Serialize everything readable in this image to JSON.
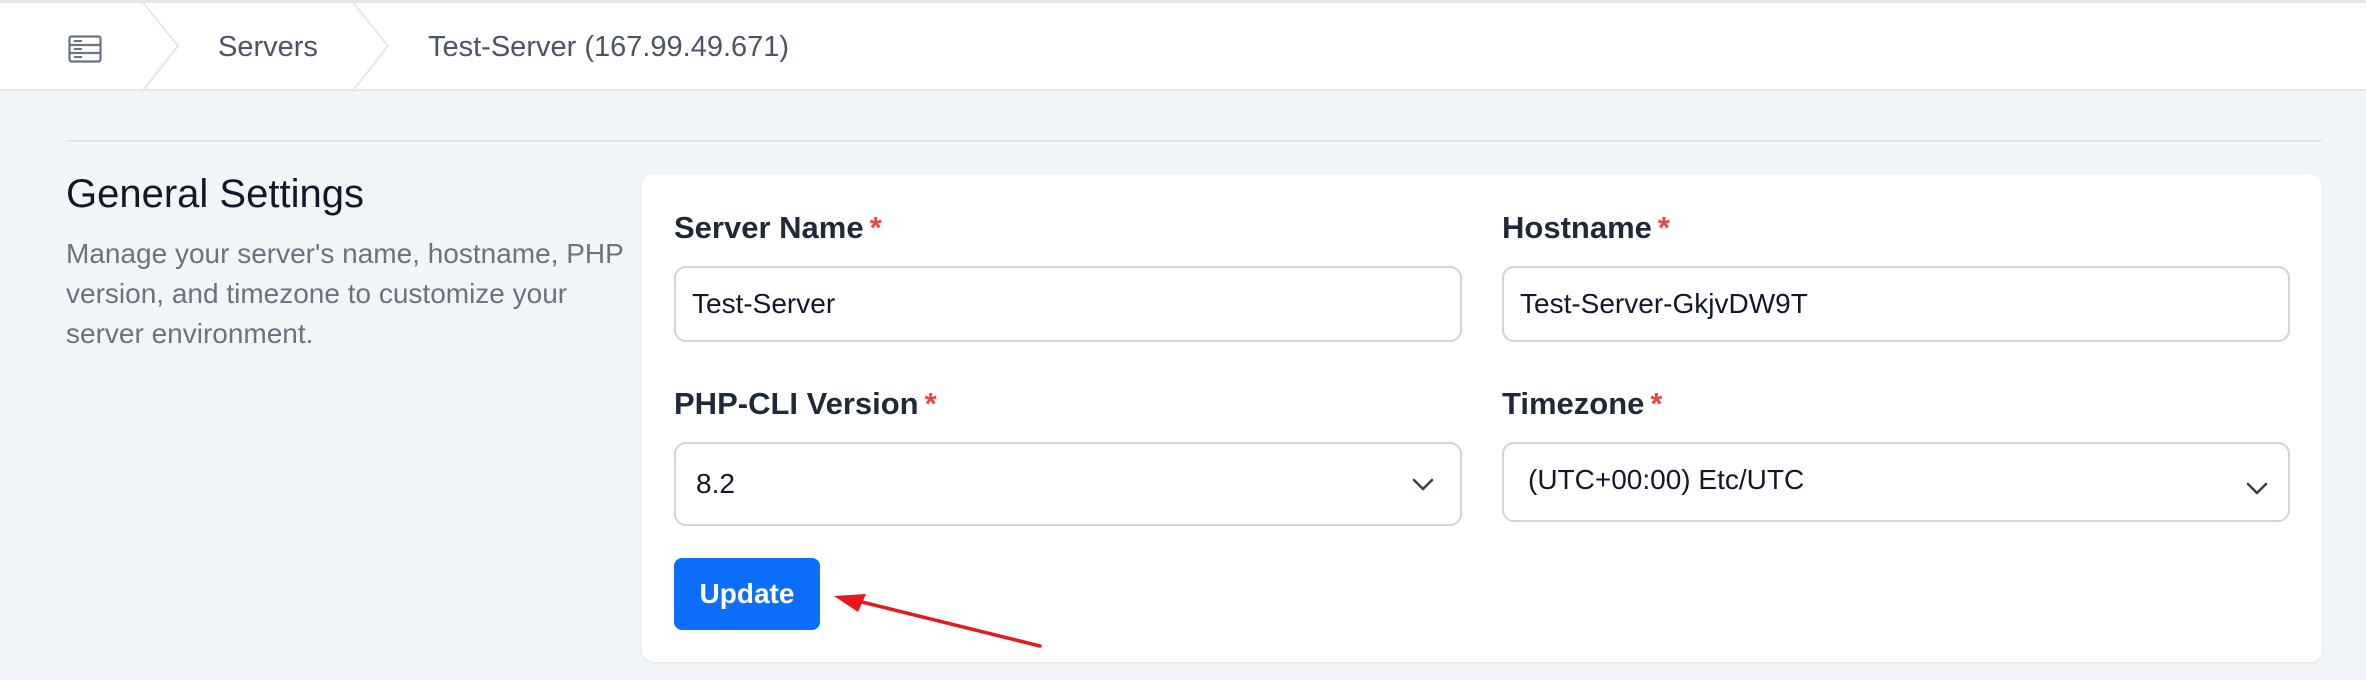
{
  "breadcrumb": {
    "home_icon": "server-icon",
    "items": [
      {
        "label": "Servers"
      },
      {
        "label": "Test-Server (167.99.49.671)"
      }
    ]
  },
  "section": {
    "title": "General Settings",
    "description": "Manage your server's name, hostname, PHP version, and timezone to customize your server environment."
  },
  "form": {
    "server_name": {
      "label": "Server Name",
      "required_mark": "*",
      "value": "Test-Server"
    },
    "hostname": {
      "label": "Hostname",
      "required_mark": "*",
      "value": "Test-Server-GkjvDW9T"
    },
    "php_cli_version": {
      "label": "PHP-CLI Version",
      "required_mark": "*",
      "selected": "8.2"
    },
    "timezone": {
      "label": "Timezone",
      "required_mark": "*",
      "selected": "(UTC+00:00) Etc/UTC"
    },
    "update_label": "Update"
  },
  "colors": {
    "primary": "#0d6efd",
    "required": "#ef4444",
    "annotation": "#e8171b"
  }
}
